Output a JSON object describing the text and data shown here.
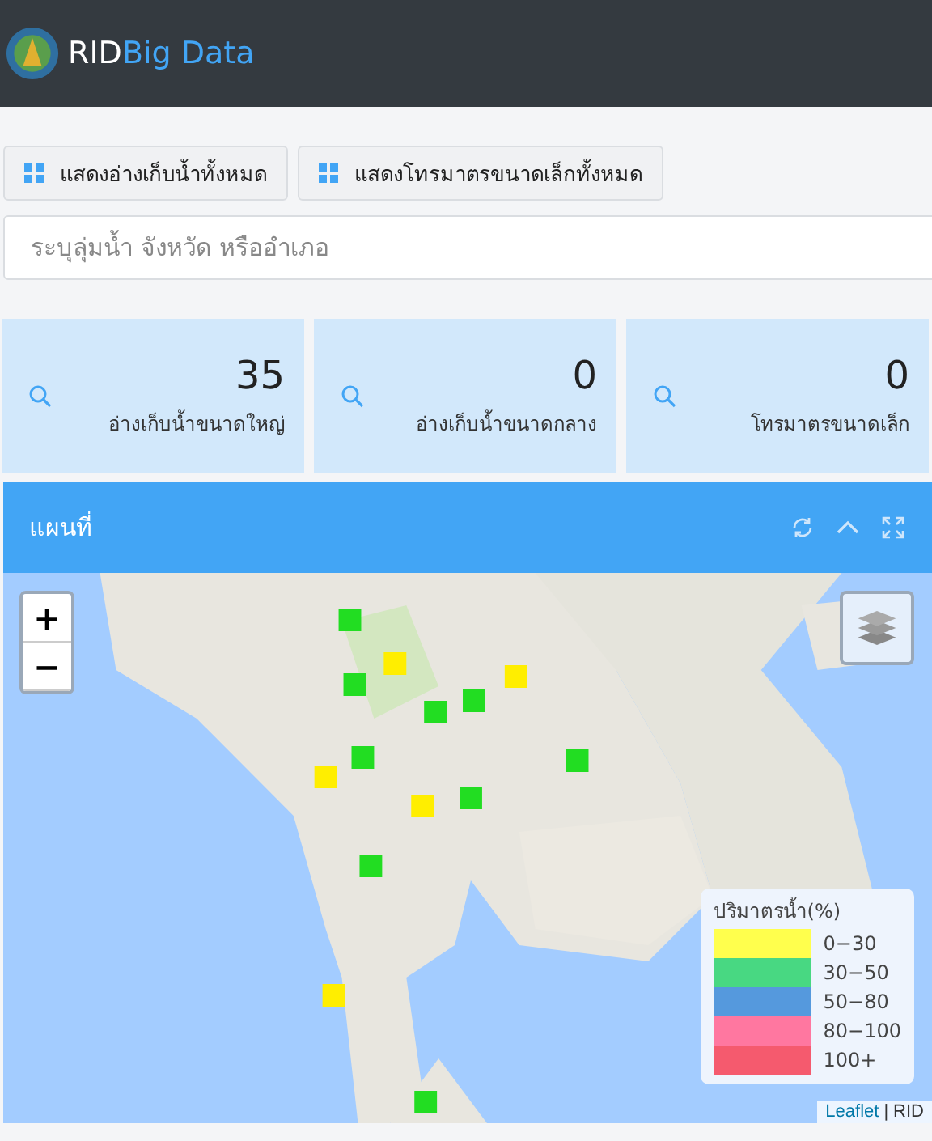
{
  "header": {
    "brand_prefix": "RID",
    "brand_suffix": "Big Data"
  },
  "buttons": [
    {
      "label": "แสดงอ่างเก็บน้ำทั้งหมด"
    },
    {
      "label": "แสดงโทรมาตรขนาดเล็กทั้งหมด"
    }
  ],
  "search": {
    "placeholder": "ระบุลุ่มน้ำ จังหวัด หรืออำเภอ"
  },
  "stats": [
    {
      "count": "35",
      "label": "อ่างเก็บน้ำขนาดใหญ่"
    },
    {
      "count": "0",
      "label": "อ่างเก็บน้ำขนาดกลาง"
    },
    {
      "count": "0",
      "label": "โทรมาตรขนาดเล็ก"
    }
  ],
  "map_panel": {
    "title": "แผนที่",
    "zoom_in": "+",
    "zoom_out": "−",
    "legend": {
      "title": "ปริมาตรน้ำ(%)",
      "items": [
        {
          "label": "0−30",
          "color": "#ffff4d"
        },
        {
          "label": "30−50",
          "color": "#48d882"
        },
        {
          "label": "50−80",
          "color": "#5599dd"
        },
        {
          "label": "80−100",
          "color": "#ff77a0"
        },
        {
          "label": "100+",
          "color": "#f55a6e"
        }
      ]
    },
    "attribution": {
      "link": "Leaflet",
      "separator": "|",
      "text": "RID"
    }
  }
}
